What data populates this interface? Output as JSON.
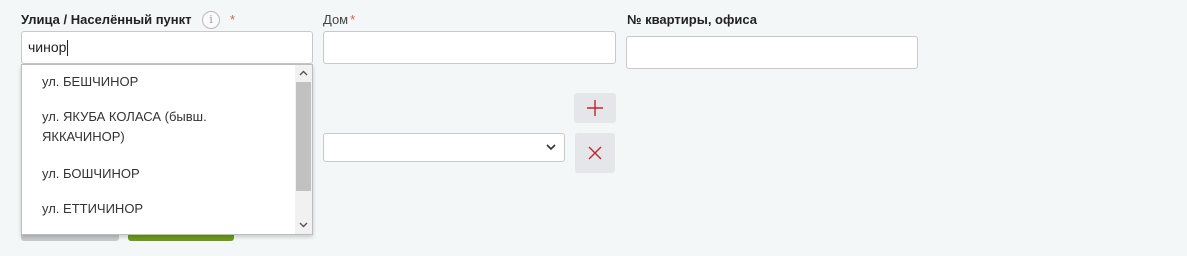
{
  "fields": {
    "street": {
      "label": "Улица / Населённый пункт",
      "required_mark": "*",
      "info_icon": "info-icon",
      "value": "чинор"
    },
    "house": {
      "label": "Дом",
      "required_mark": "*",
      "value": ""
    },
    "apartment": {
      "label": "№ квартиры, офиса",
      "value": ""
    },
    "extra_select": {
      "value": ""
    }
  },
  "suggestions": [
    "ул. БЕШЧИНОР",
    "ул. ЯКУБА КОЛАСА (бывш. ЯККАЧИНОР)",
    "ул. БОШЧИНОР",
    "ул. ЕТТИЧИНОР"
  ],
  "icons": {
    "add": "plus-icon",
    "remove": "close-icon",
    "select": "chevron-down-icon"
  },
  "colors": {
    "required": "#e05a4e",
    "action_icon": "#c0262d",
    "primary_button": "#6c9c1c",
    "background": "#f4f7f7"
  }
}
